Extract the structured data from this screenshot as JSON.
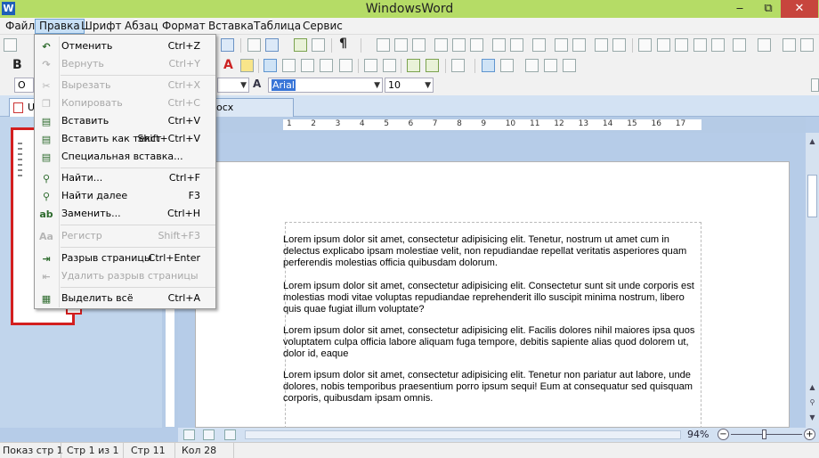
{
  "titlebar": {
    "title": "WindowsWord",
    "app_icon": "W",
    "minimize": "‒",
    "maximize": "⧉",
    "close": "✕"
  },
  "menubar": {
    "items": [
      "Файл",
      "Правка",
      "Шрифт",
      "Абзац",
      "Формат",
      "Вставка",
      "Таблица",
      "Сервис"
    ],
    "active": "Правка"
  },
  "format_bar": {
    "style_value": "О",
    "font_icon": "A",
    "font_value": "Arial",
    "size_value": "10"
  },
  "tabs": [
    {
      "label": "U"
    },
    {
      "label": "осх"
    }
  ],
  "ruler_numbers": [
    "1",
    "2",
    "3",
    "4",
    "5",
    "6",
    "7",
    "8",
    "9",
    "10",
    "11",
    "12",
    "13",
    "14",
    "15",
    "16",
    "17"
  ],
  "edit_menu": {
    "items": [
      {
        "label": "Отменить",
        "shortcut": "Ctrl+Z",
        "enabled": true,
        "icon": "undo-icon",
        "glyph": "↶"
      },
      {
        "label": "Вернуть",
        "shortcut": "Ctrl+Y",
        "enabled": false,
        "icon": "redo-icon",
        "glyph": "↷"
      },
      {
        "label": "Вырезать",
        "shortcut": "Ctrl+X",
        "enabled": false,
        "icon": "cut-icon",
        "glyph": "✂"
      },
      {
        "label": "Копировать",
        "shortcut": "Ctrl+C",
        "enabled": false,
        "icon": "copy-icon",
        "glyph": "❐"
      },
      {
        "label": "Вставить",
        "shortcut": "Ctrl+V",
        "enabled": true,
        "icon": "paste-icon",
        "glyph": "▤"
      },
      {
        "label": "Вставить как текст",
        "shortcut": "Shift+Ctrl+V",
        "enabled": true,
        "icon": "paste-text-icon",
        "glyph": "▤"
      },
      {
        "label": "Специальная вставка...",
        "shortcut": "",
        "enabled": true,
        "icon": "paste-special-icon",
        "glyph": "▤"
      },
      {
        "label": "Найти...",
        "shortcut": "Ctrl+F",
        "enabled": true,
        "icon": "find-icon",
        "glyph": "⚲"
      },
      {
        "label": "Найти далее",
        "shortcut": "F3",
        "enabled": true,
        "icon": "find-next-icon",
        "glyph": "⚲"
      },
      {
        "label": "Заменить...",
        "shortcut": "Ctrl+H",
        "enabled": true,
        "icon": "replace-icon",
        "glyph": "ab"
      },
      {
        "label": "Регистр",
        "shortcut": "Shift+F3",
        "enabled": false,
        "icon": "case-icon",
        "glyph": "Aa"
      },
      {
        "label": "Разрыв страницы",
        "shortcut": "Ctrl+Enter",
        "enabled": true,
        "icon": "page-break-icon",
        "glyph": "⇥"
      },
      {
        "label": "Удалить разрыв страницы",
        "shortcut": "",
        "enabled": false,
        "icon": "remove-page-break-icon",
        "glyph": "⇤"
      },
      {
        "label": "Выделить всё",
        "shortcut": "Ctrl+A",
        "enabled": true,
        "icon": "select-all-icon",
        "glyph": "▦"
      }
    ]
  },
  "document": {
    "paragraphs": [
      "Lorem ipsum dolor sit amet, consectetur adipisicing elit. Tenetur, nostrum ut amet cum in delectus explicabo ipsam molestiae velit, non repudiandae repellat veritatis asperiores quam perferendis molestias officia quibusdam dolorum.",
      "Lorem ipsum dolor sit amet, consectetur adipisicing elit. Consectetur sunt sit unde corporis est molestias modi vitae voluptas repudiandae reprehenderit illo suscipit minima nostrum, libero quis quae fugiat illum voluptate?",
      "Lorem ipsum dolor sit amet, consectetur adipisicing elit. Facilis dolores nihil maiores ipsa quos voluptatem culpa officia labore aliquam fuga tempore, debitis sapiente alias quod dolorem ut, dolor id, eaque",
      "Lorem ipsum dolor sit amet, consectetur adipisicing elit. Tenetur non pariatur aut labore, unde dolores, nobis temporibus praesentium porro ipsum sequi! Eum at consequatur sed quisquam corporis, quibusdam ipsam omnis."
    ]
  },
  "statusbar": {
    "show": "Показ стр 1",
    "page": "Стр 1 из 1",
    "line": "Стр 11",
    "col": "Кол 28"
  },
  "zoom": {
    "label": "94%",
    "minus": "−",
    "plus": "+",
    "level": 0.94
  }
}
